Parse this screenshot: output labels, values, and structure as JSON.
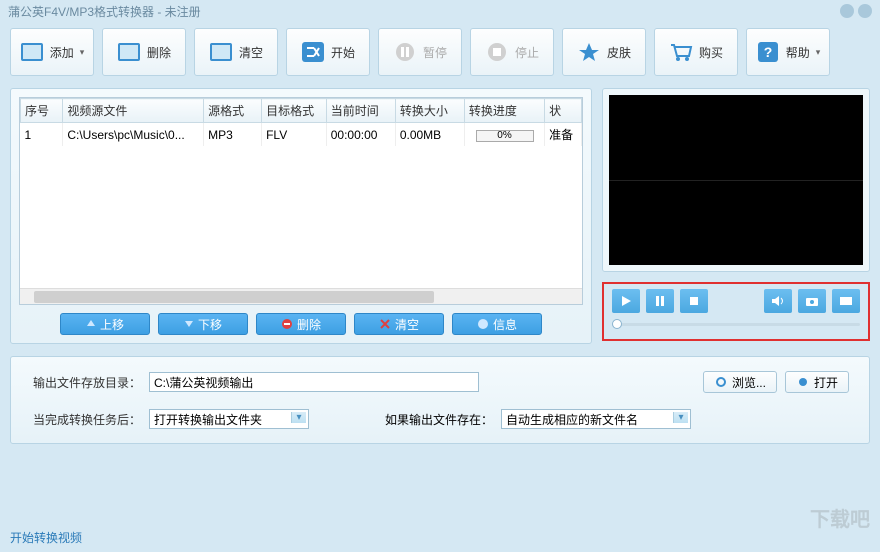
{
  "title": "蒲公英F4V/MP3格式转换器 - 未注册",
  "toolbar": {
    "add": "添加",
    "delete": "删除",
    "clear": "清空",
    "start": "开始",
    "pause": "暂停",
    "stop": "停止",
    "skin": "皮肤",
    "buy": "购买",
    "help": "帮助"
  },
  "table": {
    "headers": {
      "seq": "序号",
      "source": "视频源文件",
      "srcfmt": "源格式",
      "tgtfmt": "目标格式",
      "time": "当前时间",
      "size": "转换大小",
      "progress": "转换进度",
      "status": "状"
    },
    "rows": [
      {
        "seq": "1",
        "source": "C:\\Users\\pc\\Music\\0...",
        "srcfmt": "MP3",
        "tgtfmt": "FLV",
        "time": "00:00:00",
        "size": "0.00MB",
        "progress": "0%",
        "status": "准备"
      }
    ]
  },
  "actions": {
    "up": "上移",
    "down": "下移",
    "delete": "删除",
    "clear": "清空",
    "info": "信息"
  },
  "output": {
    "dir_label": "输出文件存放目录：",
    "dir_value": "C:\\蒲公英视频输出",
    "browse": "浏览...",
    "open": "打开",
    "after_label": "当完成转换任务后：",
    "after_value": "打开转换输出文件夹",
    "exists_label": "如果输出文件存在：",
    "exists_value": "自动生成相应的新文件名"
  },
  "footer_link": "开始转换视频",
  "watermark": "下载吧"
}
